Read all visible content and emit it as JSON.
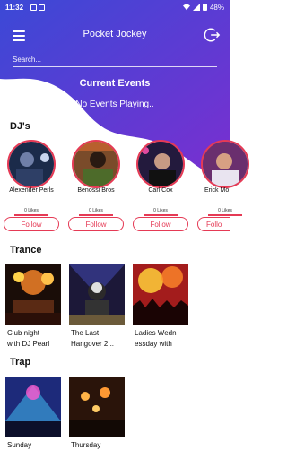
{
  "status_bar": {
    "time": "11:32",
    "battery": "48%"
  },
  "header": {
    "title": "Pocket Jockey",
    "search_placeholder": "Search...",
    "current_events_heading": "Current Events",
    "no_events_text": "No Events Playing.."
  },
  "colors": {
    "gradient_start": "#3b49d6",
    "gradient_end": "#7a2fd0",
    "accent": "#e53a55"
  },
  "djs": {
    "heading": "DJ's",
    "items": [
      {
        "name": "Alexender Perls",
        "likes": "0 Likes",
        "follow_label": "Follow"
      },
      {
        "name": "Benossi Bros",
        "likes": "0 Likes",
        "follow_label": "Follow"
      },
      {
        "name": "Carl Cox",
        "likes": "0 Likes",
        "follow_label": "Follow"
      },
      {
        "name": "Erick Mo",
        "likes": "0 Likes",
        "follow_label": "Follo"
      }
    ]
  },
  "trance": {
    "heading": "Trance",
    "events": [
      {
        "title": "Club night\nwith DJ Pearl"
      },
      {
        "title": "The Last\nHangover 2..."
      },
      {
        "title": "Ladies Wedn\nessday with"
      }
    ]
  },
  "trap": {
    "heading": "Trap",
    "events": [
      {
        "title": "Sunday"
      },
      {
        "title": "Thursday"
      }
    ]
  }
}
